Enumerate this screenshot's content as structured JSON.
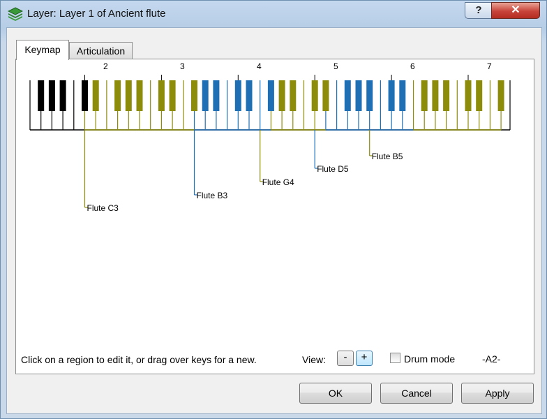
{
  "window": {
    "title": "Layer: Layer 1 of Ancient flute",
    "help_label": "?",
    "close_label": "✕"
  },
  "tabs": [
    {
      "label": "Keymap",
      "active": true
    },
    {
      "label": "Articulation",
      "active": false
    }
  ],
  "keymap": {
    "octave_labels": [
      "2",
      "3",
      "4",
      "5",
      "6",
      "7"
    ],
    "regions": [
      {
        "name": "Flute C3",
        "color": "#8c8c0a"
      },
      {
        "name": "Flute B3",
        "color": "#1f6fb5"
      },
      {
        "name": "Flute G4",
        "color": "#8c8c0a"
      },
      {
        "name": "Flute D5",
        "color": "#1f6fb5"
      },
      {
        "name": "Flute B5",
        "color": "#8c8c0a"
      }
    ]
  },
  "footer": {
    "hint": "Click on a region to edit it, or drag over keys for a new.",
    "view_label": "View:",
    "zoom_out": "-",
    "zoom_in": "+",
    "drum_mode_label": "Drum mode",
    "drum_mode_checked": false,
    "current_note": "-A2-"
  },
  "buttons": {
    "ok": "OK",
    "cancel": "Cancel",
    "apply": "Apply"
  }
}
